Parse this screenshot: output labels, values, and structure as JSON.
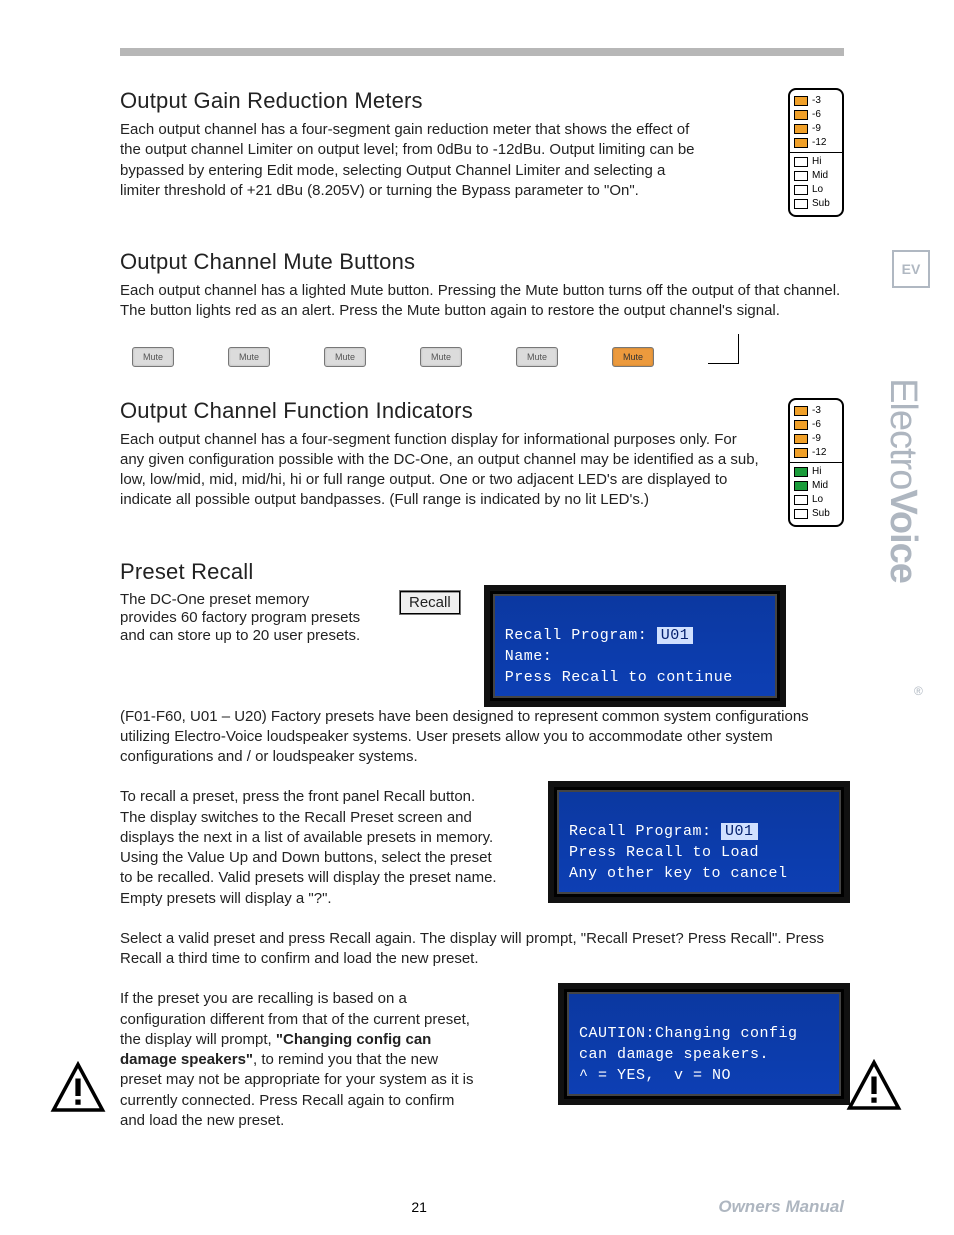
{
  "brand": {
    "sidebar": "ElectroVoice",
    "ev_short": "EV",
    "registered": "®"
  },
  "footer": {
    "page_number": "21",
    "owners_manual": "Owners Manual"
  },
  "sections": {
    "gain_reduction": {
      "title": "Output Gain Reduction Meters",
      "body": "Each output channel has a four-segment gain reduction meter that shows the effect of the output channel Limiter on output level; from 0dBu to -12dBu. Output limiting can be bypassed by entering Edit mode, selecting Output Channel Limiter and selecting a limiter threshold of +21 dBu (8.205V) or turning the Bypass parameter to \"On\"."
    },
    "mute_buttons": {
      "title": "Output Channel Mute Buttons",
      "body": "Each output channel has a lighted Mute button. Pressing the Mute button turns off the output of that channel. The button lights red as an alert. Press the Mute button again to restore the output channel's signal."
    },
    "function_indicators": {
      "title": "Output Channel Function Indicators",
      "body": "Each output channel has a four-segment function display for informational purposes only. For any given configuration possible with the DC-One, an output channel may be identified as a sub, low, low/mid, mid, mid/hi, hi or full range output. One or two adjacent LED's are displayed to indicate all possible output bandpasses. (Full range is indicated by no lit LED's.)"
    },
    "preset_recall": {
      "title": "Preset Recall",
      "p1_left": "The DC-One preset memory provides 60 factory program presets and can store up to 20 user presets.",
      "p1_rest": "(F01-F60, U01 – U20) Factory presets have been designed to represent common system configurations utilizing Electro-Voice",
      "p1_tail": "loudspeaker systems. User presets allow you to accommodate other system configurations and / or loudspeaker systems.",
      "p2": "To recall a preset, press the front panel Recall button. The display switches to the Recall Preset screen and displays the next in a list of available presets in memory. Using the Value Up and Down buttons, select the preset to be recalled. Valid presets will display the preset name. Empty presets will display a \"?\".",
      "p3": "Select a valid preset and press Recall again. The display will prompt, \"Recall Preset? Press Recall\". Press Recall a third time to confirm and load the new preset.",
      "p4_a": "If the preset you are recalling is based on a configuration different from that of the current preset, the display will prompt, ",
      "p4_bold": "\"Changing config can damage speakers\"",
      "p4_b": ", to remind you that the new preset may not be appropriate for your system as it is currently connected. Press Recall again to confirm and load the new preset."
    }
  },
  "led_meter": {
    "top_labels": [
      "-3",
      "-6",
      "-9",
      "-12"
    ],
    "bottom_labels": [
      "Hi",
      "Mid",
      "Lo",
      "Sub"
    ]
  },
  "led_function": {
    "top_labels": [
      "-3",
      "-6",
      "-9",
      "-12"
    ],
    "bottom_labels": [
      "Hi",
      "Mid",
      "Lo",
      "Sub"
    ]
  },
  "mute_label": "Mute",
  "mute_states": [
    false,
    false,
    false,
    false,
    false,
    true
  ],
  "recall_button_label": "Recall",
  "lcd_recall_1": {
    "line1_a": "Recall Program: ",
    "line1_inv": "U01",
    "line2": "Name:",
    "line3": "Press Recall to continue"
  },
  "lcd_recall_2": {
    "line1_a": "Recall Program: ",
    "line1_inv": "U01",
    "line2": "Press Recall to Load",
    "line3": "Any other key to cancel"
  },
  "lcd_caution": {
    "line1": "CAUTION:Changing config",
    "line2": "can damage speakers.",
    "line3": "^ = YES,  v = NO"
  }
}
